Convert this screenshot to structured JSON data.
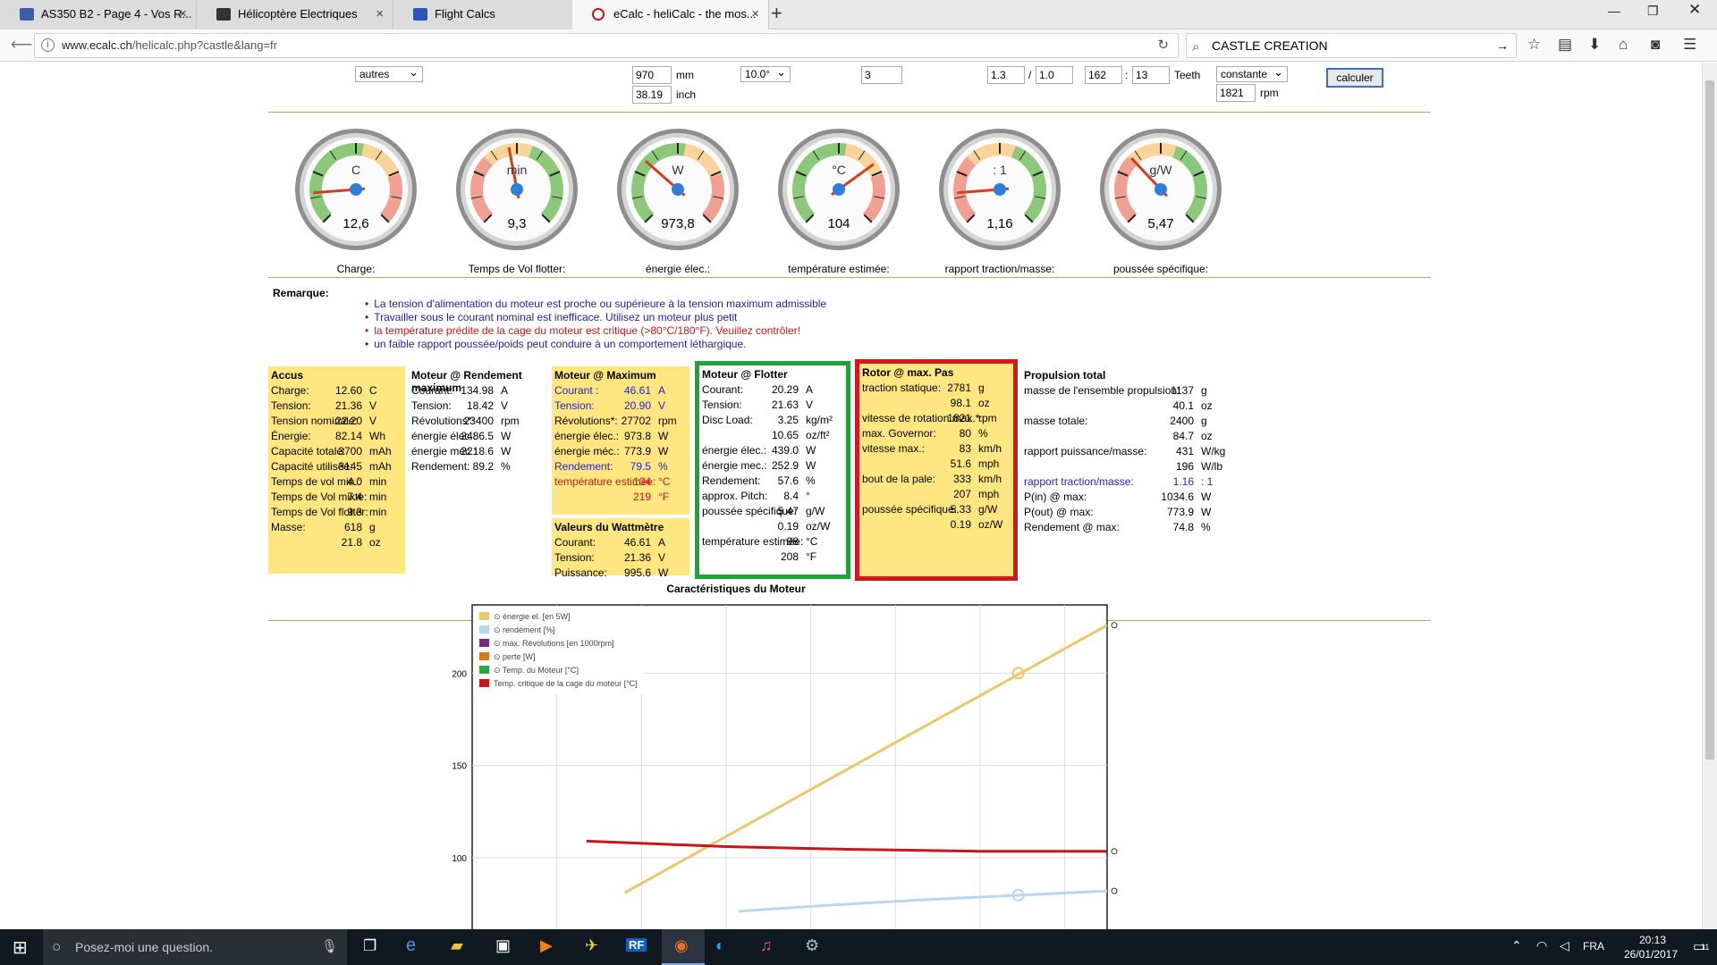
{
  "browser": {
    "tabs": [
      {
        "label": "AS350 B2 - Page 4 - Vos R...",
        "color": "#3a5fa8"
      },
      {
        "label": "Hélicoptère Electriques",
        "color": "#333333"
      },
      {
        "label": "Flight Calcs",
        "color": "#2a54b8"
      },
      {
        "label": "eCalc - heliCalc - the mos...",
        "color": "#c8161b"
      }
    ],
    "url_host": "www.ecalc.ch",
    "url_path": "/helicalc.php?castle&lang=fr",
    "search_value": "CASTLE CREATION"
  },
  "form": {
    "type_value": "autres",
    "diameter_mm": "970",
    "diameter_unit_mm": "mm",
    "diameter_inch": "38.19",
    "diameter_unit_inch": "inch",
    "pitch_value": "10.0°",
    "blades": "3",
    "ratio_a": "1.3",
    "ratio_sep": "/",
    "ratio_b": "1.0",
    "teeth_a": "162",
    "teeth_sep": ":",
    "teeth_b": "13",
    "teeth_label": "Teeth",
    "speed_mode": "constante",
    "rpm_value": "1821",
    "rpm_label": "rpm",
    "calc_label": "calculer"
  },
  "gauges": [
    {
      "unit": "C",
      "value": "12,6",
      "label": "Charge:",
      "level": 0.15
    },
    {
      "unit": "min",
      "value": "9,3",
      "label": "Temps de Vol flotter:",
      "level": 0.46
    },
    {
      "unit": "W",
      "value": "973,8",
      "label": "énergie élec.:",
      "level": 0.32
    },
    {
      "unit": "°C",
      "value": "104",
      "label": "température estimée:",
      "level": 0.7
    },
    {
      "unit": ": 1",
      "value": "1,16",
      "label": "rapport traction/masse:",
      "level": 0.15
    },
    {
      "unit": "g/W",
      "value": "5,47",
      "label": "poussée spécifique:",
      "level": 0.34
    }
  ],
  "remarks": {
    "title": "Remarque:",
    "items": [
      {
        "text": "La tension d'alimentation du moteur est proche ou supérieure à la tension maximum admissible",
        "color": "blue"
      },
      {
        "text": "Travailler sous le courant nominal est inefficace. Utilisez un moteur plus petit",
        "color": "blue"
      },
      {
        "text": "la température prédite de la cage du moteur est critique (>80°C/180°F). Veuillez contrôler!",
        "color": "red"
      },
      {
        "text": "un faible rapport poussée/poids peut conduire à un comportement léthargique.",
        "color": "blue"
      }
    ]
  },
  "tables": {
    "accus": {
      "title": "Accus",
      "rows": [
        [
          "Charge:",
          "12.60",
          "C"
        ],
        [
          "Tension:",
          "21.36",
          "V"
        ],
        [
          "Tension nominale:",
          "22.20",
          "V"
        ],
        [
          "Énergie:",
          "82.14",
          "Wh"
        ],
        [
          "Capacité totale:",
          "3700",
          "mAh"
        ],
        [
          "Capacité utilisée:",
          "3145",
          "mAh"
        ],
        [
          "Temps de vol min.:",
          "4.0",
          "min"
        ],
        [
          "Temps de Vol mixte:",
          "7.4",
          "min"
        ],
        [
          "Temps de Vol flotter:",
          "9.3",
          "min"
        ],
        [
          "Masse:",
          "618",
          "g"
        ],
        [
          "",
          "21.8",
          "oz"
        ]
      ]
    },
    "rendement": {
      "title": "Moteur @ Rendement maximum",
      "rows": [
        [
          "Courant:",
          "134.98",
          "A"
        ],
        [
          "Tension:",
          "18.42",
          "V"
        ],
        [
          "Révolutions*:",
          "23400",
          "rpm"
        ],
        [
          "énergie élec.:",
          "2486.5",
          "W"
        ],
        [
          "énergie méc.:",
          "2218.6",
          "W"
        ],
        [
          "Rendement:",
          "89.2",
          "%"
        ]
      ]
    },
    "maximum": {
      "title": "Moteur @ Maximum",
      "rows": [
        [
          "Courant :",
          "46.61",
          "A",
          "blue"
        ],
        [
          "Tension:",
          "20.90",
          "V",
          "blue"
        ],
        [
          "Révolutions*:",
          "27702",
          "rpm",
          ""
        ],
        [
          "énergie élec.:",
          "973.8",
          "W",
          ""
        ],
        [
          "énergie méc.:",
          "773.9",
          "W",
          ""
        ],
        [
          "Rendement:",
          "79.5",
          "%",
          "blue"
        ],
        [
          "température estimée:",
          "104",
          "°C",
          "red"
        ],
        [
          "",
          "219",
          "°F",
          "red"
        ]
      ]
    },
    "wattmetre": {
      "title": "Valeurs du Wattmètre",
      "rows": [
        [
          "Courant:",
          "46.61",
          "A"
        ],
        [
          "Tension:",
          "21.36",
          "V"
        ],
        [
          "Puissance:",
          "995.6",
          "W"
        ]
      ]
    },
    "flotter": {
      "title": "Moteur @ Flotter",
      "rows": [
        [
          "Courant:",
          "20.29",
          "A"
        ],
        [
          "Tension:",
          "21.63",
          "V"
        ],
        [
          "Disc Load:",
          "3.25",
          "kg/m²"
        ],
        [
          "",
          "10.65",
          "oz/ft²"
        ],
        [
          "énergie élec.:",
          "439.0",
          "W"
        ],
        [
          "énergie mec.:",
          "252.9",
          "W"
        ],
        [
          "Rendement:",
          "57.6",
          "%"
        ],
        [
          "approx. Pitch:",
          "8.4",
          "°"
        ],
        [
          "poussée spécifique:",
          "5.47",
          "g/W"
        ],
        [
          "",
          "0.19",
          "oz/W"
        ],
        [
          "température estimée:",
          "98",
          "°C"
        ],
        [
          "",
          "208",
          "°F"
        ]
      ]
    },
    "rotor": {
      "title": "Rotor @ max. Pas",
      "rows": [
        [
          "traction statique:",
          "2781",
          "g"
        ],
        [
          "",
          "98.1",
          "oz"
        ],
        [
          "vitesse de rotation max.*:",
          "1821",
          "rpm"
        ],
        [
          "max. Governor:",
          "80",
          "%"
        ],
        [
          "vitesse max.:",
          "83",
          "km/h"
        ],
        [
          "",
          "51.6",
          "mph"
        ],
        [
          "bout de la pale:",
          "333",
          "km/h"
        ],
        [
          "",
          "207",
          "mph"
        ],
        [
          "poussée spécifique:",
          "5.33",
          "g/W"
        ],
        [
          "",
          "0.19",
          "oz/W"
        ]
      ]
    },
    "propulsion": {
      "title": "Propulsion total",
      "rows": [
        [
          "masse de l'ensemble propulsion:",
          "1137",
          "g",
          ""
        ],
        [
          "",
          "40.1",
          "oz",
          ""
        ],
        [
          "masse totale:",
          "2400",
          "g",
          ""
        ],
        [
          "",
          "84.7",
          "oz",
          ""
        ],
        [
          "rapport puissance/masse:",
          "431",
          "W/kg",
          ""
        ],
        [
          "",
          "196",
          "W/lb",
          ""
        ],
        [
          "rapport traction/masse:",
          "1.16",
          ": 1",
          "blue"
        ],
        [
          "P(in) @ max:",
          "1034.6",
          "W",
          ""
        ],
        [
          "P(out) @ max:",
          "773.9",
          "W",
          ""
        ],
        [
          "Rendement @ max:",
          "74.8",
          "%",
          ""
        ]
      ]
    }
  },
  "chart_data": {
    "type": "line",
    "title": "Caractéristiques du Moteur",
    "yticks": [
      100,
      150,
      200
    ],
    "ylim": [
      53,
      237
    ],
    "xlim": [
      0,
      100
    ],
    "legend": [
      {
        "name": "énergie el. [en 5W]",
        "color": "#e8c86a"
      },
      {
        "name": "rendement [%]",
        "color": "#b9d6ea"
      },
      {
        "name": "max. Révolutions [en 1000rpm]",
        "color": "#7a2a78"
      },
      {
        "name": "perte [W]",
        "color": "#d67818"
      },
      {
        "name": "Temp. du Moteur [°C]",
        "color": "#27a83a"
      },
      {
        "name": "Temp. critique de la cage du moteur [°C]",
        "color": "#c8161b"
      }
    ],
    "series": [
      {
        "name": "énergie el. [en 5W]",
        "color": "#e8c86a",
        "x": [
          24,
          100
        ],
        "y": [
          81,
          226
        ]
      },
      {
        "name": "rendement [%]",
        "color": "#b9d6ea",
        "x": [
          42,
          55,
          70,
          85,
          100
        ],
        "y": [
          71,
          74,
          77,
          79.5,
          82
        ]
      },
      {
        "name": "Temp. critique de la cage du moteur [°C]",
        "color": "#c8161b",
        "x": [
          18,
          40,
          60,
          80,
          100
        ],
        "y": [
          109,
          106,
          104.5,
          103.5,
          103.5
        ]
      }
    ]
  },
  "taskbar": {
    "search_placeholder": "Posez-moi une question.",
    "lang": "FRA",
    "time": "20:13",
    "date": "26/01/2017",
    "notif": "11"
  }
}
